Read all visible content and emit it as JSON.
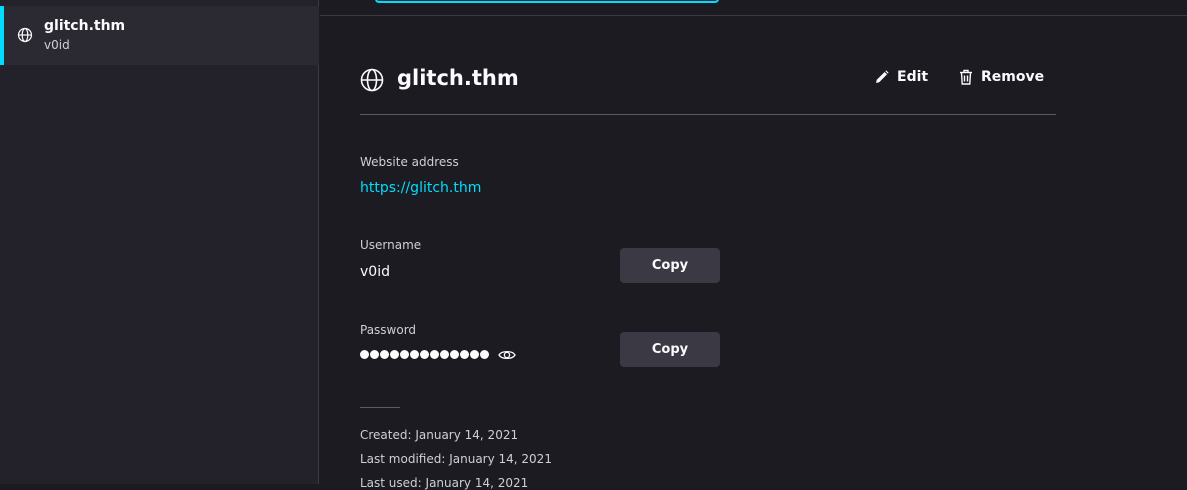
{
  "sidebar": {
    "items": [
      {
        "title": "glitch.thm",
        "subtitle": "v0id",
        "icon": "globe-icon"
      }
    ]
  },
  "detail": {
    "site_title": "glitch.thm",
    "edit_label": "Edit",
    "remove_label": "Remove",
    "website": {
      "label": "Website address",
      "value": "https://glitch.thm"
    },
    "username": {
      "label": "Username",
      "value": "v0id",
      "copy_label": "Copy"
    },
    "password": {
      "label": "Password",
      "masked_length": 13,
      "copy_label": "Copy"
    },
    "meta": {
      "created": "Created: January 14, 2021",
      "modified": "Last modified: January 14, 2021",
      "used": "Last used: January 14, 2021"
    }
  },
  "colors": {
    "accent": "#00ddff",
    "background": "#1c1b22",
    "sidebar": "#23222b",
    "button": "#3a3944"
  }
}
